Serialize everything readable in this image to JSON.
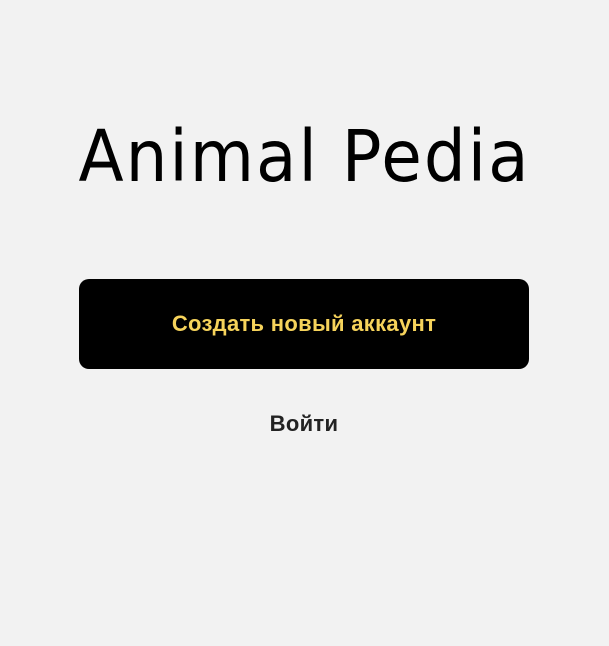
{
  "app": {
    "title": "Animal Pedia"
  },
  "actions": {
    "create_account_label": "Создать новый аккаунт",
    "login_label": "Войти"
  },
  "colors": {
    "background": "#f2f2f2",
    "primary_button_bg": "#000000",
    "primary_button_text": "#f6d35b",
    "secondary_text": "#222222"
  }
}
